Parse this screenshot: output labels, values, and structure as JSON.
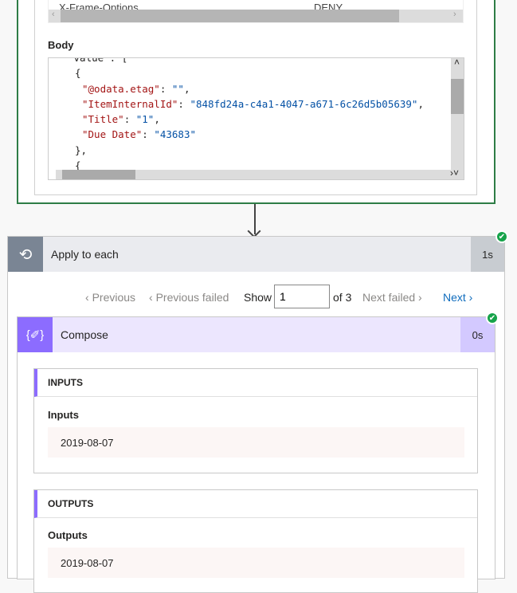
{
  "headers_table": {
    "name": "X-Frame-Options",
    "value": "DENY"
  },
  "body_label": "Body",
  "code_lines": [
    {
      "indent": 2,
      "parts": [
        [
          "p",
          "\"value\": ["
        ]
      ]
    },
    {
      "indent": 3,
      "parts": [
        [
          "p",
          "{"
        ]
      ]
    },
    {
      "indent": 4,
      "parts": [
        [
          "k",
          "\"@odata.etag\""
        ],
        [
          "p",
          ": "
        ],
        [
          "s",
          "\"\""
        ],
        [
          "p",
          ","
        ]
      ]
    },
    {
      "indent": 4,
      "parts": [
        [
          "k",
          "\"ItemInternalId\""
        ],
        [
          "p",
          ": "
        ],
        [
          "s",
          "\"848fd24a-c4a1-4047-a671-6c26d5b05639\""
        ],
        [
          "p",
          ","
        ]
      ]
    },
    {
      "indent": 4,
      "parts": [
        [
          "k",
          "\"Title\""
        ],
        [
          "p",
          ": "
        ],
        [
          "s",
          "\"1\""
        ],
        [
          "p",
          ","
        ]
      ]
    },
    {
      "indent": 4,
      "parts": [
        [
          "k",
          "\"Due Date\""
        ],
        [
          "p",
          ": "
        ],
        [
          "s",
          "\"43683\""
        ]
      ]
    },
    {
      "indent": 3,
      "parts": [
        [
          "p",
          "},"
        ]
      ]
    },
    {
      "indent": 3,
      "parts": [
        [
          "p",
          "{"
        ]
      ]
    }
  ],
  "apply_to_each": {
    "title": "Apply to each",
    "duration": "1s",
    "status": "succeeded",
    "icon": "loop-icon"
  },
  "pager": {
    "previous": "Previous",
    "previous_failed": "Previous failed",
    "show": "Show",
    "current": "1",
    "of": "of 3",
    "next_failed": "Next failed",
    "next": "Next"
  },
  "compose": {
    "title": "Compose",
    "duration": "0s",
    "status": "succeeded",
    "icon": "compose-icon"
  },
  "inputs": {
    "section": "INPUTS",
    "label": "Inputs",
    "value": "2019-08-07"
  },
  "outputs": {
    "section": "OUTPUTS",
    "label": "Outputs",
    "value": "2019-08-07"
  },
  "colors": {
    "success": "#16a34a",
    "compose": "#8c6cff",
    "loop": "#7a8594",
    "link": "#0f6cbd"
  }
}
